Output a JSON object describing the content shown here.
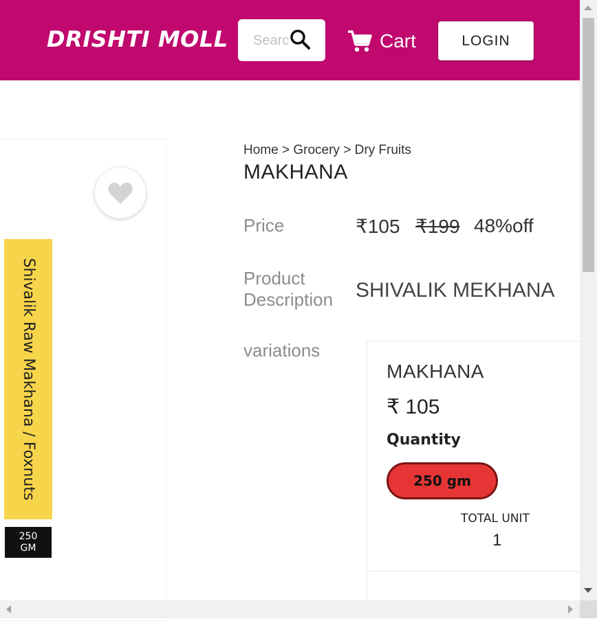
{
  "header": {
    "brand": "DRISHTI MOLL",
    "search_placeholder": "Search",
    "cart_label": "Cart",
    "login_label": "LOGIN",
    "bg_color": "#c0086e"
  },
  "breadcrumb": {
    "items": [
      "Home",
      "Grocery",
      "Dry Fruits"
    ],
    "separator": ">"
  },
  "product": {
    "title": "MAKHANA",
    "price_label": "Price",
    "price_current": "₹105",
    "price_mrp": "₹199",
    "discount": "48%off",
    "description_label_line1": "Product",
    "description_label_line2": "Description",
    "description": "SHIVALIK MEKHANA",
    "variations_label": "variations"
  },
  "image_card": {
    "pack_text": "Shivalik Raw Makhana / Foxnuts",
    "pack_weight_line1": "250",
    "pack_weight_line2": "GM",
    "wishlist_icon": "heart-icon"
  },
  "variation": {
    "name": "MAKHANA",
    "price": "₹ 105",
    "quantity_label": "Quantity",
    "quantity_option": "250 gm",
    "total_unit_label": "TOTAL UNIT",
    "total_unit_value": "1",
    "option_color": "#e53535"
  }
}
